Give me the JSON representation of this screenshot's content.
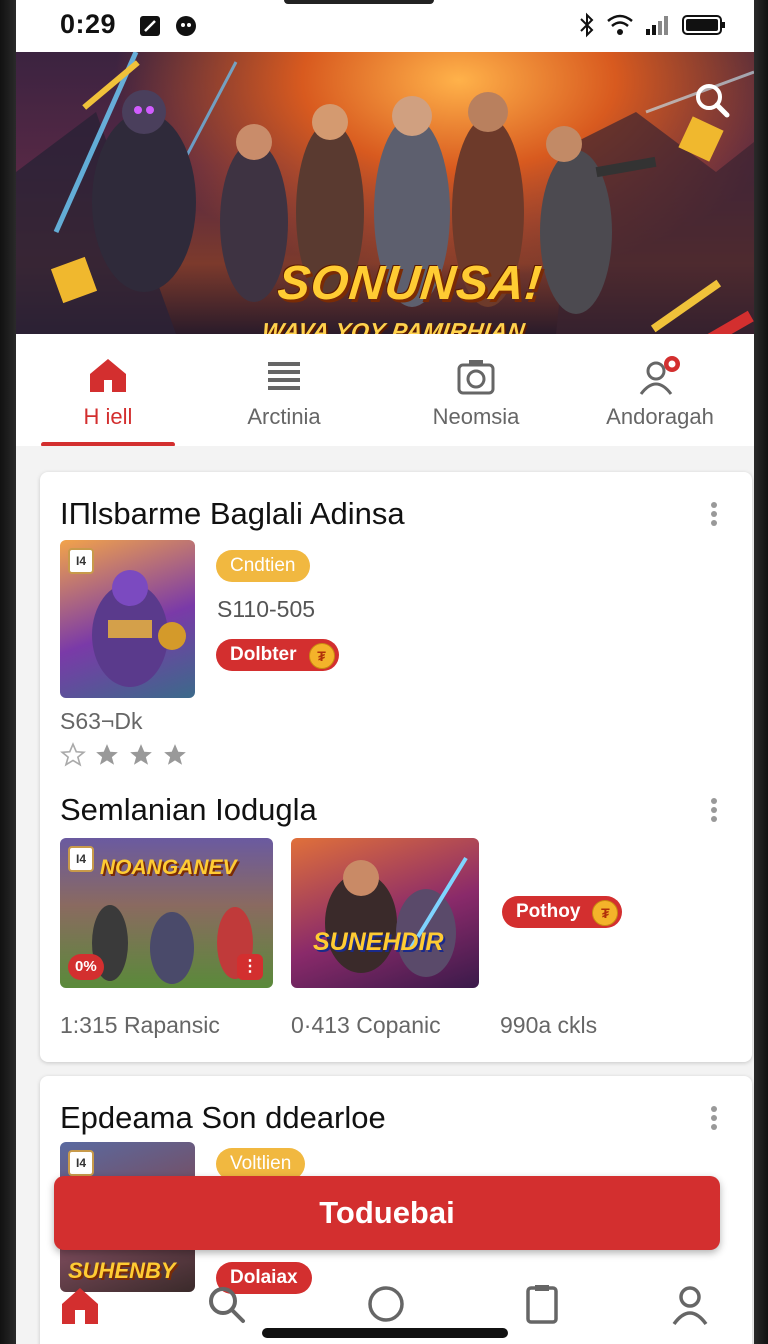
{
  "status": {
    "time": "0:29"
  },
  "hero": {
    "title": "SONUNSA!",
    "subtitle": "WAVA YOY PAMIRHIAN"
  },
  "tabs": [
    {
      "label": "H iell",
      "icon": "home-icon",
      "active": true
    },
    {
      "label": "Arctinia",
      "icon": "list-icon",
      "active": false
    },
    {
      "label": "Neomsia",
      "icon": "camera-icon",
      "active": false
    },
    {
      "label": "Andoragah",
      "icon": "profile-notification-icon",
      "active": false
    }
  ],
  "cards": {
    "first": {
      "title": "IΠlsbarme Baglali Adinsa",
      "thumb_badge": "I4",
      "tag": "Cndtien",
      "price": "S110-505",
      "action": "Dolbter",
      "coin": "₮",
      "sub": "S63¬Dk",
      "rating": 3
    },
    "second": {
      "title": "Semlanian Iodugla",
      "thumb1_badge": "I4",
      "thumb1_title": "NOANGANEV",
      "thumb1_percent": "0%",
      "thumb2_title": "SUNEHDIR",
      "action": "Pothoy",
      "coin": "₮",
      "meta": [
        "1:315 Rapansic",
        "0·413 Copanic",
        "990a ckls"
      ]
    },
    "third": {
      "title": "Epdeama Son ddearloe",
      "thumb_badge": "I4",
      "thumb_title": "SUHENBY",
      "tag": "Voltlien",
      "action": "Dolaiax"
    }
  },
  "cta": {
    "label": "Toduebai"
  },
  "colors": {
    "accent": "#d32f2f",
    "tag_yellow": "#f1b840"
  }
}
